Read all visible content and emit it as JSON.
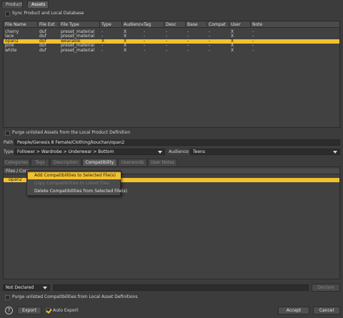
{
  "tabs": {
    "product": "Product",
    "assets": "Assets"
  },
  "sync": {
    "label": "Sync Product and Local Database",
    "checked": false
  },
  "table": {
    "columns": [
      "File Name",
      "File Ext",
      "File Type",
      "Type",
      "Audience",
      "Tag",
      "Desc",
      "Base",
      "Compat",
      "User",
      "Note"
    ],
    "rows": [
      {
        "name": "cherry",
        "ext": "duf",
        "ftype": "preset_material",
        "type": "-",
        "audience": "X",
        "tag": "-",
        "desc": "-",
        "base": "-",
        "compat": "-",
        "user": "X",
        "note": "-",
        "selected": false
      },
      {
        "name": "lace",
        "ext": "duf",
        "ftype": "preset_material",
        "type": "-",
        "audience": "X",
        "tag": "-",
        "desc": "-",
        "base": "-",
        "compat": "-",
        "user": "X",
        "note": "-",
        "selected": false
      },
      {
        "name": "opan2",
        "ext": "duf",
        "ftype": "wearable",
        "type": "X",
        "audience": "X",
        "tag": "-",
        "desc": "-",
        "base": "-",
        "compat": "-",
        "user": "X",
        "note": "-",
        "selected": true
      },
      {
        "name": "pink",
        "ext": "duf",
        "ftype": "preset_material",
        "type": "-",
        "audience": "X",
        "tag": "-",
        "desc": "-",
        "base": "-",
        "compat": "-",
        "user": "X",
        "note": "-",
        "selected": false
      },
      {
        "name": "white",
        "ext": "duf",
        "ftype": "preset_material",
        "type": "-",
        "audience": "X",
        "tag": "-",
        "desc": "-",
        "base": "-",
        "compat": "-",
        "user": "X",
        "note": "-",
        "selected": false
      }
    ]
  },
  "purge_assets": {
    "label": "Purge unlisted Assets from the Local Product Definition",
    "checked": false
  },
  "path": {
    "label": "Path",
    "value": "People/Genesis 8 Female/Clothing/kouchan/opan2"
  },
  "type_row": {
    "type_label": "Type",
    "type_value": "Follower > Wardrobe > Underwear > Bottom",
    "audience_label": "Audience :",
    "audience_value": "Teens"
  },
  "sub_tabs": [
    "Categories",
    "Tags",
    "Description",
    "Compatibility",
    "Userwords",
    "User Notes"
  ],
  "active_sub_tab": "Compatibility",
  "compat": {
    "header": "Files / Com",
    "row": "opan2"
  },
  "context_menu": {
    "items": [
      {
        "label": "Add Compatibilities to Selected File(s)",
        "state": "highlight"
      },
      {
        "label": "Copy Compatibilities to Listed Files",
        "state": "disabled"
      },
      {
        "label": "Delete Compatibilities from Selected File(s)",
        "state": "normal"
      }
    ]
  },
  "bottom_bar": {
    "not_declared": "Not Declared",
    "declare_button": "Declare"
  },
  "purge_compat": {
    "label": "Purge unlisted Compatibilities from Local Asset Definitions",
    "checked": false
  },
  "footer": {
    "help": "?",
    "export": "Export",
    "auto_export": "Auto Export",
    "auto_export_checked": true,
    "accept": "Accept",
    "cancel": "Cancel"
  },
  "colors": {
    "accent": "#f2c12e",
    "background": "#3c3c3c"
  }
}
